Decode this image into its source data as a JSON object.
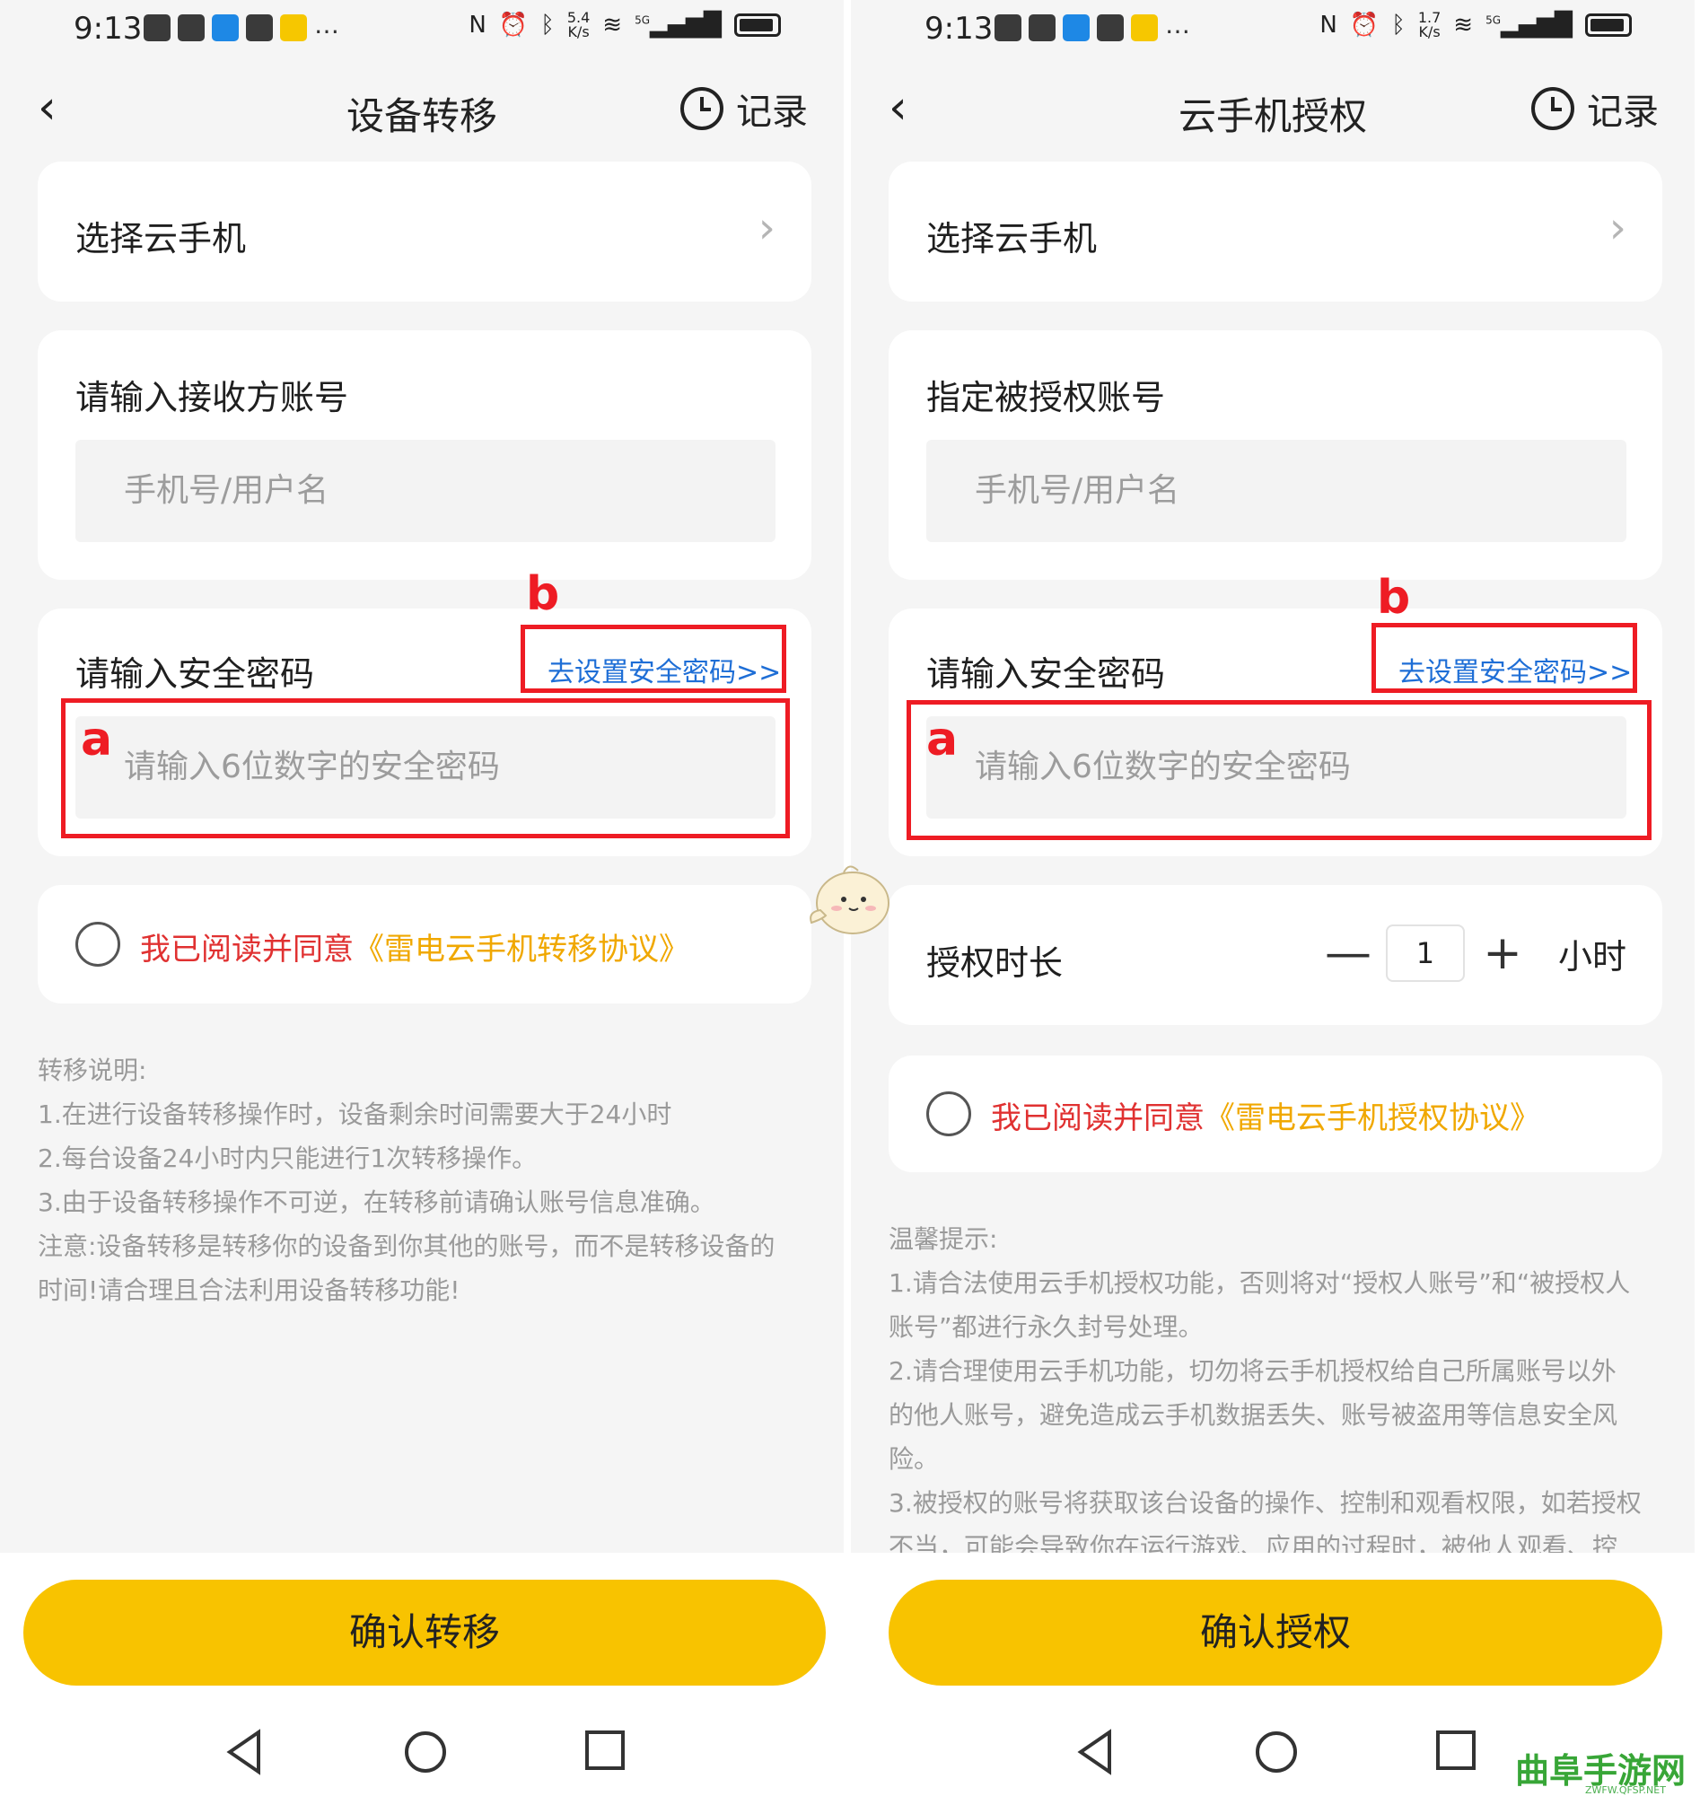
{
  "left": {
    "status": {
      "time": "9:13",
      "speed_top": "5.4",
      "speed_unit": "K/s",
      "net": "5G"
    },
    "header": {
      "back": "‹",
      "title": "设备转移",
      "record": "记录"
    },
    "select_card": {
      "label": "选择云手机",
      "chevron": "›"
    },
    "account_card": {
      "label": "请输入接收方账号",
      "placeholder": "手机号/用户名"
    },
    "password_card": {
      "label": "请输入安全密码",
      "link": "去设置安全密码>>",
      "placeholder": "请输入6位数字的安全密码",
      "mark_a": "a",
      "mark_b": "b"
    },
    "agree": {
      "text": "我已阅读并同意",
      "protocol": "《雷电云手机转移协议》"
    },
    "notes": [
      "转移说明:",
      "1.在进行设备转移操作时，设备剩余时间需要大于24小时",
      "2.每台设备24小时内只能进行1次转移操作。",
      "3.由于设备转移操作不可逆，在转移前请确认账号信息准确。",
      "注意:设备转移是转移你的设备到你其他的账号，而不是转移设备的",
      "时间!请合理且合法利用设备转移功能!"
    ],
    "confirm": "确认转移"
  },
  "right": {
    "status": {
      "time": "9:13",
      "speed_top": "1.7",
      "speed_unit": "K/s",
      "net": "5G"
    },
    "header": {
      "back": "‹",
      "title": "云手机授权",
      "record": "记录"
    },
    "select_card": {
      "label": "选择云手机",
      "chevron": "›"
    },
    "account_card": {
      "label": "指定被授权账号",
      "placeholder": "手机号/用户名"
    },
    "password_card": {
      "label": "请输入安全密码",
      "link": "去设置安全密码>>",
      "placeholder": "请输入6位数字的安全密码",
      "mark_a": "a",
      "mark_b": "b"
    },
    "duration": {
      "label": "授权时长",
      "minus": "—",
      "value": "1",
      "plus": "+",
      "unit": "小时"
    },
    "agree": {
      "text": "我已阅读并同意",
      "protocol": "《雷电云手机授权协议》"
    },
    "notes": [
      "温馨提示:",
      "1.请合法使用云手机授权功能，否则将对“授权人账号”和“被授权人",
      "账号”都进行永久封号处理。",
      "2.请合理使用云手机功能，切勿将云手机授权给自己所属账号以外",
      "的他人账号，避免造成云手机数据丢失、账号被盗用等信息安全风",
      "险。",
      "3.被授权的账号将获取该台设备的操作、控制和观看权限，如若授权",
      "不当，可能会导致你在运行游戏、应用的过程时，被他人观看、控"
    ],
    "confirm": "确认授权"
  },
  "watermark": {
    "title": "曲阜手游网",
    "url": "ZWFW.QFSP.NET"
  },
  "colors": {
    "accent": "#f8c300",
    "link": "#1e6ed6",
    "annotation": "#ee1c24",
    "agree_text": "#e03131",
    "protocol": "#f0a800",
    "background": "#f5f5f5"
  },
  "icons": [
    "back-arrow-icon",
    "clock-icon",
    "chevron-right-icon",
    "radio-icon",
    "nav-back-icon",
    "nav-home-icon",
    "nav-recents-icon",
    "mascot-icon"
  ]
}
